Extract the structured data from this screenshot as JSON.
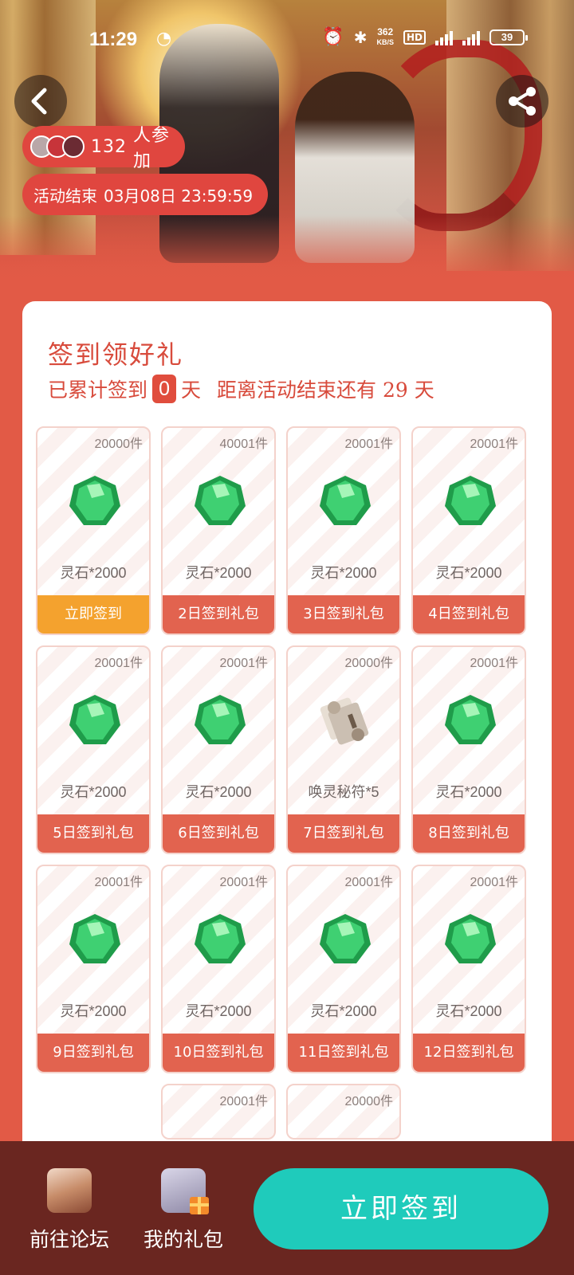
{
  "status_bar": {
    "time": "11:29",
    "net_speed_value": "362",
    "net_speed_unit": "KB/S",
    "hd": "HD",
    "battery": "39"
  },
  "header": {
    "participants_count": "132",
    "participants_suffix": "人参加",
    "end_label": "活动结束",
    "end_time": "03月08日 23:59:59"
  },
  "checkin": {
    "title": "签到领好礼",
    "accumulated_prefix": "已累计签到",
    "accumulated_days": "0",
    "days_unit": "天",
    "remaining_text": "距离活动结束还有 29 天"
  },
  "rewards": [
    {
      "stock": "20000件",
      "reward": "灵石*2000",
      "button": "立即签到",
      "icon": "green-gem-icon",
      "active": true
    },
    {
      "stock": "40001件",
      "reward": "灵石*2000",
      "button": "2日签到礼包",
      "icon": "green-gem-icon"
    },
    {
      "stock": "20001件",
      "reward": "灵石*2000",
      "button": "3日签到礼包",
      "icon": "green-gem-icon"
    },
    {
      "stock": "20001件",
      "reward": "灵石*2000",
      "button": "4日签到礼包",
      "icon": "green-gem-icon"
    },
    {
      "stock": "20001件",
      "reward": "灵石*2000",
      "button": "5日签到礼包",
      "icon": "green-gem-icon"
    },
    {
      "stock": "20001件",
      "reward": "灵石*2000",
      "button": "6日签到礼包",
      "icon": "green-gem-icon"
    },
    {
      "stock": "20000件",
      "reward": "唤灵秘符*5",
      "button": "7日签到礼包",
      "icon": "scroll-icon"
    },
    {
      "stock": "20001件",
      "reward": "灵石*2000",
      "button": "8日签到礼包",
      "icon": "green-gem-icon"
    },
    {
      "stock": "20001件",
      "reward": "灵石*2000",
      "button": "9日签到礼包",
      "icon": "green-gem-icon"
    },
    {
      "stock": "20001件",
      "reward": "灵石*2000",
      "button": "10日签到礼包",
      "icon": "green-gem-icon"
    },
    {
      "stock": "20001件",
      "reward": "灵石*2000",
      "button": "11日签到礼包",
      "icon": "green-gem-icon"
    },
    {
      "stock": "20001件",
      "reward": "灵石*2000",
      "button": "12日签到礼包",
      "icon": "green-gem-icon"
    },
    {
      "stock": "20001件"
    },
    {
      "stock": "20000件"
    }
  ],
  "bottom_nav": {
    "forum_label": "前往论坛",
    "gifts_label": "我的礼包",
    "signin_label": "立即签到"
  },
  "colors": {
    "page_bg": "#e25a46",
    "accent_red": "#d84b3c",
    "tile_button": "#e2634f",
    "tile_button_active": "#f4a22e",
    "signin_button": "#1fcbbb",
    "bottom_bar": "#6a2620"
  }
}
